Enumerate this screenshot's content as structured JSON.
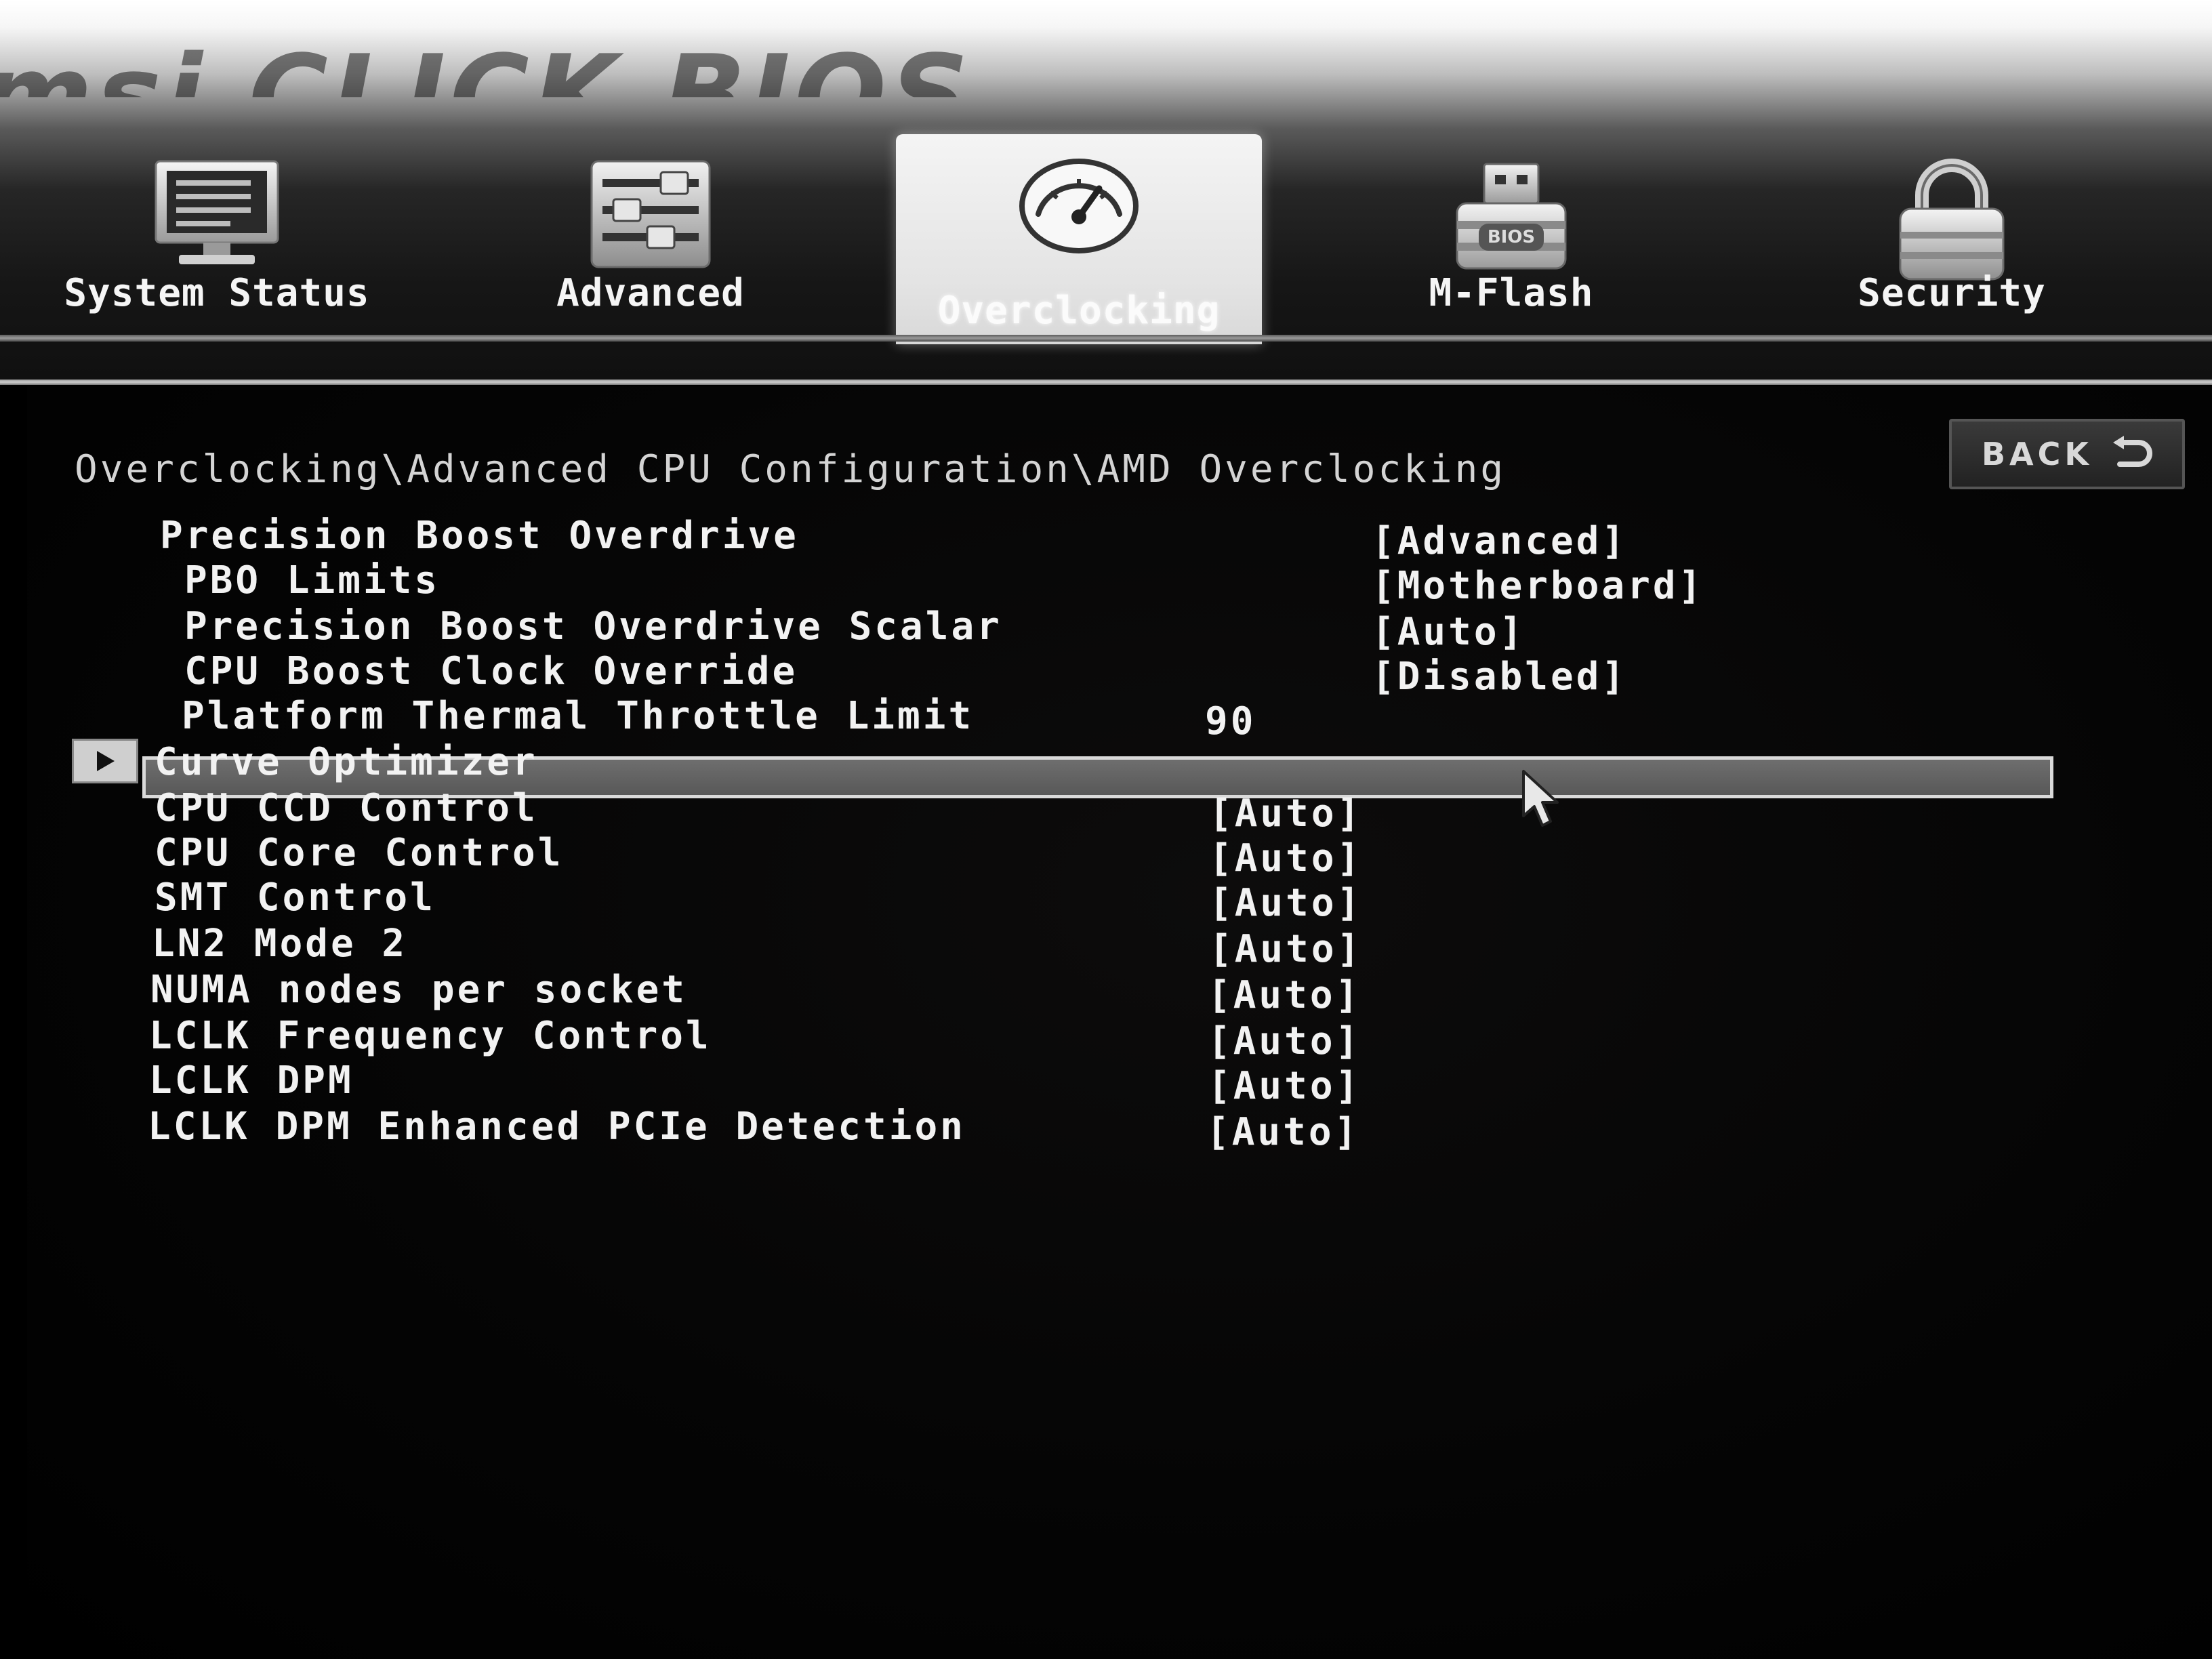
{
  "brand": {
    "text": "msi CLICK BIOS"
  },
  "tabs": [
    {
      "label": "System Status",
      "icon": "monitor-icon"
    },
    {
      "label": "Advanced",
      "icon": "sliders-icon"
    },
    {
      "label": "Overclocking",
      "icon": "speedometer-icon",
      "active": true
    },
    {
      "label": "M-Flash",
      "icon": "bios-flash-drive-icon"
    },
    {
      "label": "Security",
      "icon": "padlock-icon"
    }
  ],
  "back_button": {
    "label": "BACK",
    "icon": "return-arrow-icon"
  },
  "breadcrumb": "Overclocking\\Advanced CPU Configuration\\AMD Overclocking",
  "settings": [
    {
      "name": "Precision Boost Overdrive",
      "value": "[Advanced]"
    },
    {
      "name": "PBO Limits",
      "value": "[Motherboard]"
    },
    {
      "name": "Precision Boost Overdrive Scalar",
      "value": "[Auto]"
    },
    {
      "name": "CPU Boost Clock Override",
      "value": "[Disabled]"
    },
    {
      "name": "Platform Thermal Throttle Limit",
      "value": "90"
    },
    {
      "name": "Curve Optimizer",
      "value": "",
      "selected": true,
      "submenu": true
    },
    {
      "name": "CPU CCD Control",
      "value": "[Auto]"
    },
    {
      "name": "CPU Core Control",
      "value": "[Auto]"
    },
    {
      "name": "SMT Control",
      "value": "[Auto]"
    },
    {
      "name": "LN2 Mode 2",
      "value": "[Auto]"
    },
    {
      "name": "NUMA nodes per socket",
      "value": "[Auto]"
    },
    {
      "name": "LCLK Frequency Control",
      "value": "[Auto]"
    },
    {
      "name": "LCLK DPM",
      "value": "[Auto]"
    },
    {
      "name": "LCLK DPM Enhanced PCIe Detection",
      "value": "[Auto]"
    }
  ],
  "colors": {
    "text": "#f2f2f2",
    "background": "#000000",
    "selected_bar": "#5e5e5e",
    "selected_border": "#d9d9d9",
    "active_tab": "#e8e8e8"
  }
}
